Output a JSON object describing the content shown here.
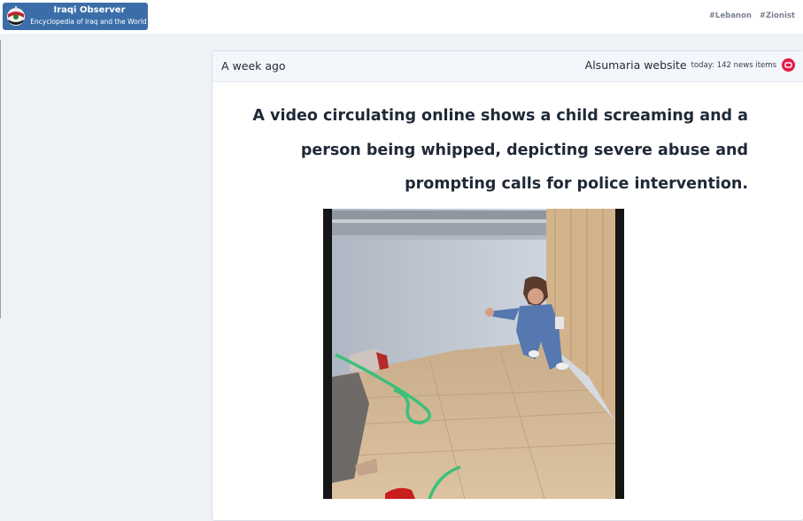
{
  "header": {
    "logo_title": "Iraqi Observer",
    "logo_subtitle": "Encyclopedia of Iraq and the World",
    "tags": [
      "#Lebanon",
      "#Zionist"
    ]
  },
  "article": {
    "time": "A week ago",
    "source": "Alsumaria website",
    "today_count": "today: 142 news items",
    "headline": "A video circulating online shows a child screaming and a person being whipped, depicting severe abuse and prompting calls for police intervention."
  },
  "colors": {
    "logo_bg": "#3b6ea8",
    "page_bg": "#eef1f6",
    "source_icon": "#e11d48",
    "headline_text": "#1f2937"
  },
  "icons": {
    "logo": "iraqi-observer-emblem-icon",
    "source": "alsumaria-logo-icon"
  }
}
